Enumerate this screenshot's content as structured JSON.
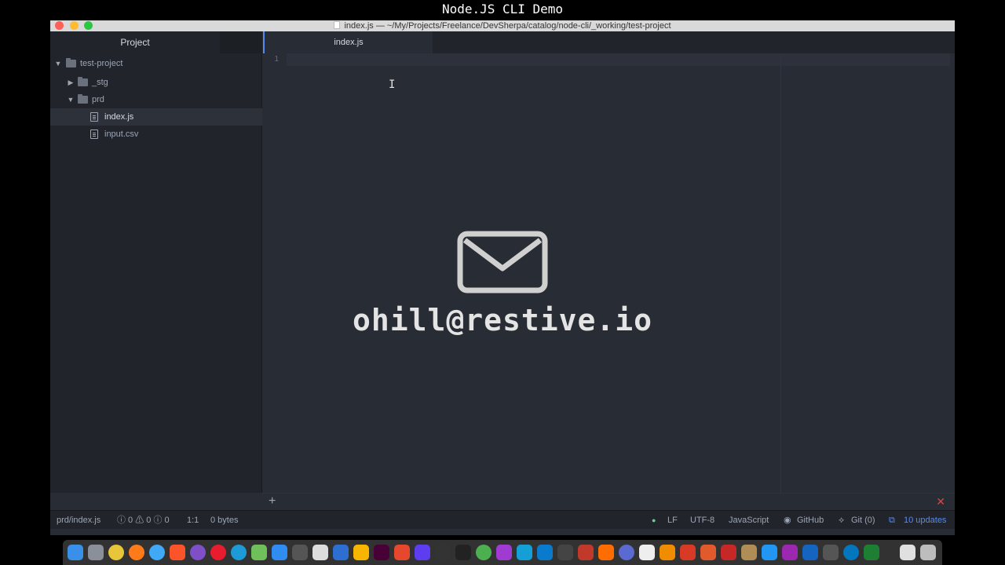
{
  "overlay": {
    "title": "Node.JS CLI Demo"
  },
  "window": {
    "title": "index.js — ~/My/Projects/Freelance/DevSherpa/catalog/node-cli/_working/test-project"
  },
  "sidebar": {
    "tab_label": "Project",
    "tree": {
      "root": "test-project",
      "folders": [
        "_stg",
        "prd"
      ],
      "files": [
        "index.js",
        "input.csv"
      ]
    }
  },
  "editor": {
    "tab_label": "index.js",
    "line_number": "1"
  },
  "overlay_email": {
    "text": "ohill@restive.io",
    "icon": "mail-icon"
  },
  "statusbar": {
    "path": "prd/index.js",
    "diagnostics": "ⓘ 0 ⚠ 0 ⓘ 0",
    "cursor": "1:1",
    "size": "0 bytes",
    "line_ending": "LF",
    "encoding": "UTF-8",
    "grammar": "JavaScript",
    "github": "GitHub",
    "git": "Git (0)",
    "updates": "10 updates"
  },
  "colors": {
    "accent": "#568af2",
    "background": "#282c34",
    "sidebar": "#21252b",
    "error": "#e0443e"
  }
}
